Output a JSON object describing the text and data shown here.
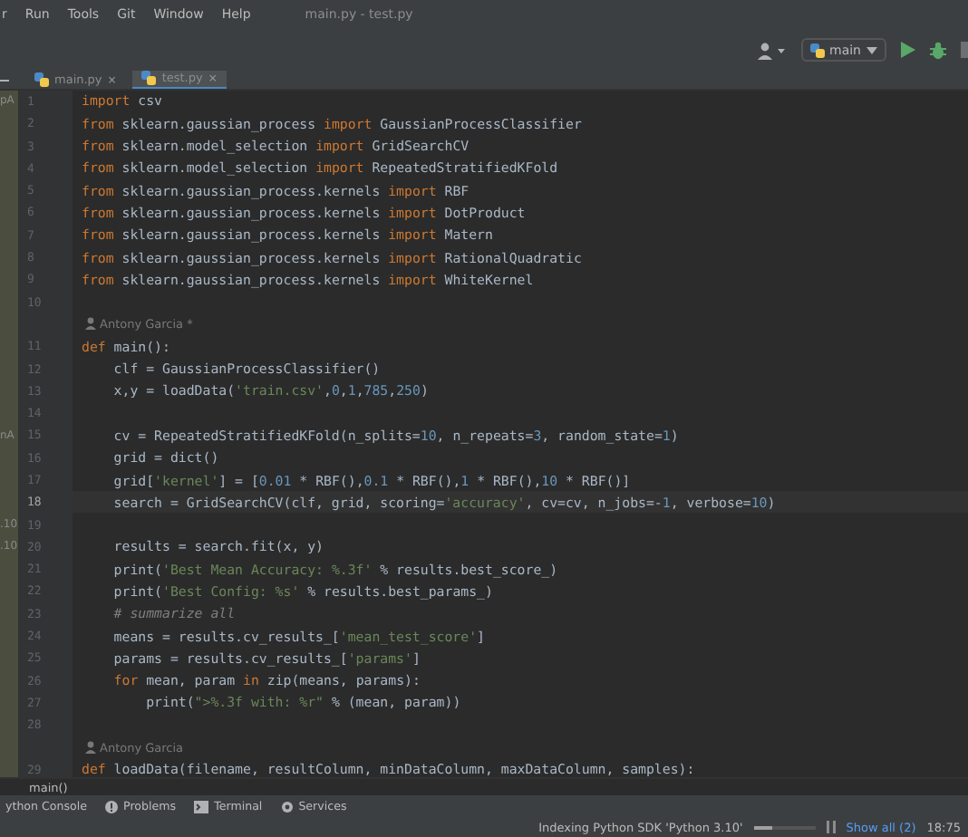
{
  "menu": {
    "items": [
      "r",
      "Run",
      "Tools",
      "Git",
      "Window",
      "Help"
    ],
    "title": "main.py - test.py"
  },
  "toolbar": {
    "run_config": "main"
  },
  "tabs": [
    {
      "label": "main.py",
      "close": "×",
      "selected": false
    },
    {
      "label": "test.py",
      "close": "×",
      "selected": true
    }
  ],
  "editor": {
    "lines": [
      {
        "kind": "code",
        "number": "1",
        "side": "pA",
        "selected": false,
        "tokens": [
          {
            "kind": "keyword",
            "text": "import"
          },
          {
            "kind": "plain",
            "text": " csv"
          }
        ]
      },
      {
        "kind": "code",
        "number": "2",
        "selected": false,
        "tokens": [
          {
            "kind": "keyword",
            "text": "from"
          },
          {
            "kind": "plain",
            "text": " sklearn.gaussian_process "
          },
          {
            "kind": "keyword",
            "text": "import"
          },
          {
            "kind": "plain",
            "text": " GaussianProcessClassifier"
          }
        ]
      },
      {
        "kind": "code",
        "number": "3",
        "selected": false,
        "tokens": [
          {
            "kind": "keyword",
            "text": "from"
          },
          {
            "kind": "plain",
            "text": " sklearn.model_selection "
          },
          {
            "kind": "keyword",
            "text": "import"
          },
          {
            "kind": "plain",
            "text": " GridSearchCV"
          }
        ]
      },
      {
        "kind": "code",
        "number": "4",
        "selected": false,
        "tokens": [
          {
            "kind": "keyword",
            "text": "from"
          },
          {
            "kind": "plain",
            "text": " sklearn.model_selection "
          },
          {
            "kind": "keyword",
            "text": "import"
          },
          {
            "kind": "plain",
            "text": " RepeatedStratifiedKFold"
          }
        ]
      },
      {
        "kind": "code",
        "number": "5",
        "selected": false,
        "tokens": [
          {
            "kind": "keyword",
            "text": "from"
          },
          {
            "kind": "plain",
            "text": " sklearn.gaussian_process.kernels "
          },
          {
            "kind": "keyword",
            "text": "import"
          },
          {
            "kind": "plain",
            "text": " RBF"
          }
        ]
      },
      {
        "kind": "code",
        "number": "6",
        "selected": false,
        "tokens": [
          {
            "kind": "keyword",
            "text": "from"
          },
          {
            "kind": "plain",
            "text": " sklearn.gaussian_process.kernels "
          },
          {
            "kind": "keyword",
            "text": "import"
          },
          {
            "kind": "plain",
            "text": " DotProduct"
          }
        ]
      },
      {
        "kind": "code",
        "number": "7",
        "selected": false,
        "tokens": [
          {
            "kind": "keyword",
            "text": "from"
          },
          {
            "kind": "plain",
            "text": " sklearn.gaussian_process.kernels "
          },
          {
            "kind": "keyword",
            "text": "import"
          },
          {
            "kind": "plain",
            "text": " Matern"
          }
        ]
      },
      {
        "kind": "code",
        "number": "8",
        "selected": false,
        "tokens": [
          {
            "kind": "keyword",
            "text": "from"
          },
          {
            "kind": "plain",
            "text": " sklearn.gaussian_process.kernels "
          },
          {
            "kind": "keyword",
            "text": "import"
          },
          {
            "kind": "plain",
            "text": " RationalQuadratic"
          }
        ]
      },
      {
        "kind": "code",
        "number": "9",
        "selected": false,
        "tokens": [
          {
            "kind": "keyword",
            "text": "from"
          },
          {
            "kind": "plain",
            "text": " sklearn.gaussian_process.kernels "
          },
          {
            "kind": "keyword",
            "text": "import"
          },
          {
            "kind": "plain",
            "text": " WhiteKernel"
          }
        ]
      },
      {
        "kind": "code",
        "number": "10",
        "selected": false
      },
      {
        "kind": "author",
        "text": "Antony Garcia *"
      },
      {
        "kind": "code",
        "number": "11",
        "selected": false,
        "tokens": [
          {
            "kind": "keyword",
            "text": "def"
          },
          {
            "kind": "plain",
            "text": " main():"
          }
        ]
      },
      {
        "kind": "code",
        "number": "12",
        "selected": false,
        "tokens": [
          {
            "kind": "plain",
            "text": "    clf = GaussianProcessClassifier()"
          }
        ]
      },
      {
        "kind": "code",
        "number": "13",
        "selected": false,
        "tokens": [
          {
            "kind": "plain",
            "text": "    x,y = loadData("
          },
          {
            "kind": "string",
            "text": "'train.csv'"
          },
          {
            "kind": "plain",
            "text": ","
          },
          {
            "kind": "number",
            "text": "0"
          },
          {
            "kind": "plain",
            "text": ","
          },
          {
            "kind": "number",
            "text": "1"
          },
          {
            "kind": "plain",
            "text": ","
          },
          {
            "kind": "number",
            "text": "785"
          },
          {
            "kind": "plain",
            "text": ","
          },
          {
            "kind": "number",
            "text": "250"
          },
          {
            "kind": "plain",
            "text": ")"
          }
        ]
      },
      {
        "kind": "code",
        "number": "14",
        "selected": false
      },
      {
        "kind": "code",
        "number": "15",
        "side": "nA",
        "selected": false,
        "tokens": [
          {
            "kind": "plain",
            "text": "    cv = RepeatedStratifiedKFold(n_splits="
          },
          {
            "kind": "number",
            "text": "10"
          },
          {
            "kind": "plain",
            "text": ", n_repeats="
          },
          {
            "kind": "number",
            "text": "3"
          },
          {
            "kind": "plain",
            "text": ", random_state="
          },
          {
            "kind": "number",
            "text": "1"
          },
          {
            "kind": "plain",
            "text": ")"
          }
        ]
      },
      {
        "kind": "code",
        "number": "16",
        "selected": false,
        "tokens": [
          {
            "kind": "plain",
            "text": "    grid = dict()"
          }
        ]
      },
      {
        "kind": "code",
        "number": "17",
        "selected": false,
        "tokens": [
          {
            "kind": "plain",
            "text": "    grid["
          },
          {
            "kind": "string",
            "text": "'kernel'"
          },
          {
            "kind": "plain",
            "text": "] = ["
          },
          {
            "kind": "number",
            "text": "0.01"
          },
          {
            "kind": "plain",
            "text": " * RBF(),"
          },
          {
            "kind": "number",
            "text": "0.1"
          },
          {
            "kind": "plain",
            "text": " * RBF(),"
          },
          {
            "kind": "number",
            "text": "1"
          },
          {
            "kind": "plain",
            "text": " * RBF(),"
          },
          {
            "kind": "number",
            "text": "10"
          },
          {
            "kind": "plain",
            "text": " * RBF()]"
          }
        ]
      },
      {
        "kind": "code",
        "number": "18",
        "selected": true,
        "tokens": [
          {
            "kind": "plain",
            "text": "    search = GridSearchCV(clf, grid, scoring="
          },
          {
            "kind": "string",
            "text": "'accuracy'"
          },
          {
            "kind": "plain",
            "text": ", cv=cv, n_jobs=-"
          },
          {
            "kind": "number",
            "text": "1"
          },
          {
            "kind": "plain",
            "text": ", verbose="
          },
          {
            "kind": "number",
            "text": "10"
          },
          {
            "kind": "plain",
            "text": ")"
          }
        ]
      },
      {
        "kind": "code",
        "number": "19",
        "side": ".10",
        "selected": false
      },
      {
        "kind": "code",
        "number": "20",
        "side": ".10",
        "selected": false,
        "tokens": [
          {
            "kind": "plain",
            "text": "    results = search.fit(x, y)"
          }
        ]
      },
      {
        "kind": "code",
        "number": "21",
        "selected": false,
        "tokens": [
          {
            "kind": "plain",
            "text": "    print("
          },
          {
            "kind": "string",
            "text": "'Best Mean Accuracy: %.3f'"
          },
          {
            "kind": "plain",
            "text": " % results.best_score_)"
          }
        ]
      },
      {
        "kind": "code",
        "number": "22",
        "selected": false,
        "tokens": [
          {
            "kind": "plain",
            "text": "    print("
          },
          {
            "kind": "string",
            "text": "'Best Config: %s'"
          },
          {
            "kind": "plain",
            "text": " % results.best_params_)"
          }
        ]
      },
      {
        "kind": "code",
        "number": "23",
        "selected": false,
        "tokens": [
          {
            "kind": "comment",
            "text": "    # summarize all"
          }
        ]
      },
      {
        "kind": "code",
        "number": "24",
        "selected": false,
        "tokens": [
          {
            "kind": "plain",
            "text": "    means = results.cv_results_["
          },
          {
            "kind": "string",
            "text": "'mean_test_score'"
          },
          {
            "kind": "plain",
            "text": "]"
          }
        ]
      },
      {
        "kind": "code",
        "number": "25",
        "selected": false,
        "tokens": [
          {
            "kind": "plain",
            "text": "    params = results.cv_results_["
          },
          {
            "kind": "string",
            "text": "'params'"
          },
          {
            "kind": "plain",
            "text": "]"
          }
        ]
      },
      {
        "kind": "code",
        "number": "26",
        "selected": false,
        "tokens": [
          {
            "kind": "keyword",
            "text": "    for"
          },
          {
            "kind": "plain",
            "text": " mean, param "
          },
          {
            "kind": "keyword",
            "text": "in"
          },
          {
            "kind": "plain",
            "text": " zip(means, params):"
          }
        ]
      },
      {
        "kind": "code",
        "number": "27",
        "selected": false,
        "tokens": [
          {
            "kind": "plain",
            "text": "        print("
          },
          {
            "kind": "string",
            "text": "\">%.3f with: %r\""
          },
          {
            "kind": "plain",
            "text": " % (mean, param))"
          }
        ]
      },
      {
        "kind": "code",
        "number": "28",
        "selected": false
      },
      {
        "kind": "author",
        "text": "Antony Garcia"
      },
      {
        "kind": "code",
        "number": "29",
        "selected": false,
        "tokens": [
          {
            "kind": "keyword",
            "text": "def"
          },
          {
            "kind": "plain",
            "text": " loadData(filename, resultColumn, minDataColumn, maxDataColumn, samples):"
          }
        ]
      }
    ]
  },
  "breadcrumb": "main()",
  "tool_windows": [
    {
      "kind": "console",
      "label": "ython Console"
    },
    {
      "kind": "problems",
      "label": "Problems"
    },
    {
      "kind": "terminal",
      "label": "Terminal"
    },
    {
      "kind": "services",
      "label": "Services"
    }
  ],
  "status_bar": {
    "task": "Indexing Python SDK 'Python 3.10'",
    "level": 0.3,
    "show_all": "Show all (2)",
    "position": "18:75"
  }
}
